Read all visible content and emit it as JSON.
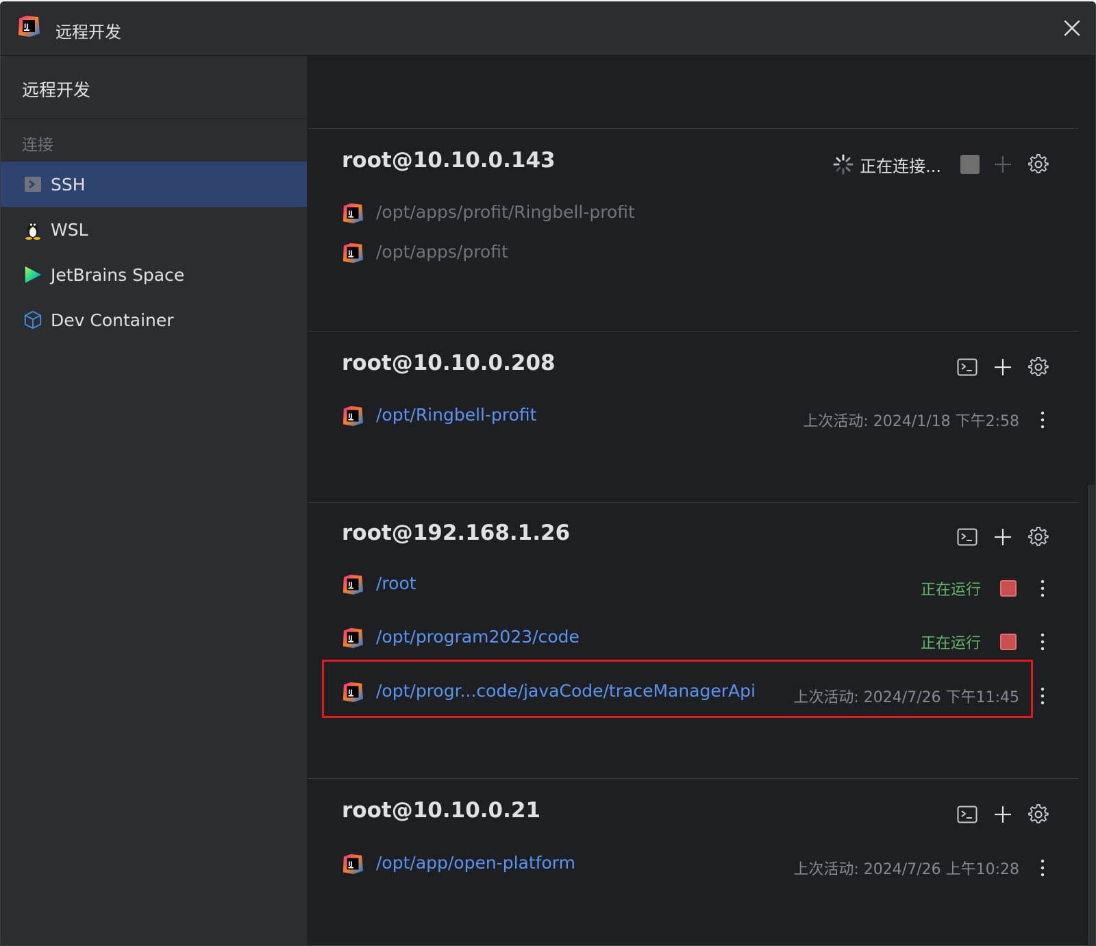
{
  "window": {
    "title": "远程开发",
    "close_icon": "close-icon",
    "logo_icon": "intellij-logo-icon"
  },
  "sidebar": {
    "header": "远程开发",
    "section_label": "连接",
    "items": [
      {
        "label": "SSH",
        "icon": "terminal-icon",
        "selected": true
      },
      {
        "label": "WSL",
        "icon": "linux-penguin-icon",
        "selected": false
      },
      {
        "label": "JetBrains Space",
        "icon": "jetbrains-space-icon",
        "selected": false
      },
      {
        "label": "Dev Container",
        "icon": "cube-icon",
        "selected": false
      }
    ]
  },
  "hosts": [
    {
      "name": "root@10.10.0.143",
      "status_text": "正在连接...",
      "projects": [
        {
          "path": "/opt/apps/profit/Ringbell-profit"
        },
        {
          "path": "/opt/apps/profit"
        }
      ]
    },
    {
      "name": "root@10.10.0.208",
      "projects": [
        {
          "path": "/opt/Ringbell-profit",
          "last_active": "上次活动: 2024/1/18 下午2:58"
        }
      ]
    },
    {
      "name": "root@192.168.1.26",
      "projects": [
        {
          "path": "/root",
          "status": "正在运行"
        },
        {
          "path": "/opt/program2023/code",
          "status": "正在运行"
        },
        {
          "path": "/opt/progr...code/javaCode/traceManagerApi",
          "last_active": "上次活动: 2024/7/26 下午11:45",
          "highlighted": true
        }
      ]
    },
    {
      "name": "root@10.10.0.21",
      "projects": [
        {
          "path": "/opt/app/open-platform",
          "last_active": "上次活动: 2024/7/26 上午10:28"
        }
      ]
    }
  ],
  "colors": {
    "accent_link": "#5994f0",
    "running_green": "#5fb865",
    "stop_red": "#c94f4f",
    "selection_bg": "#2e436e",
    "highlight_border": "#e11b1b"
  }
}
